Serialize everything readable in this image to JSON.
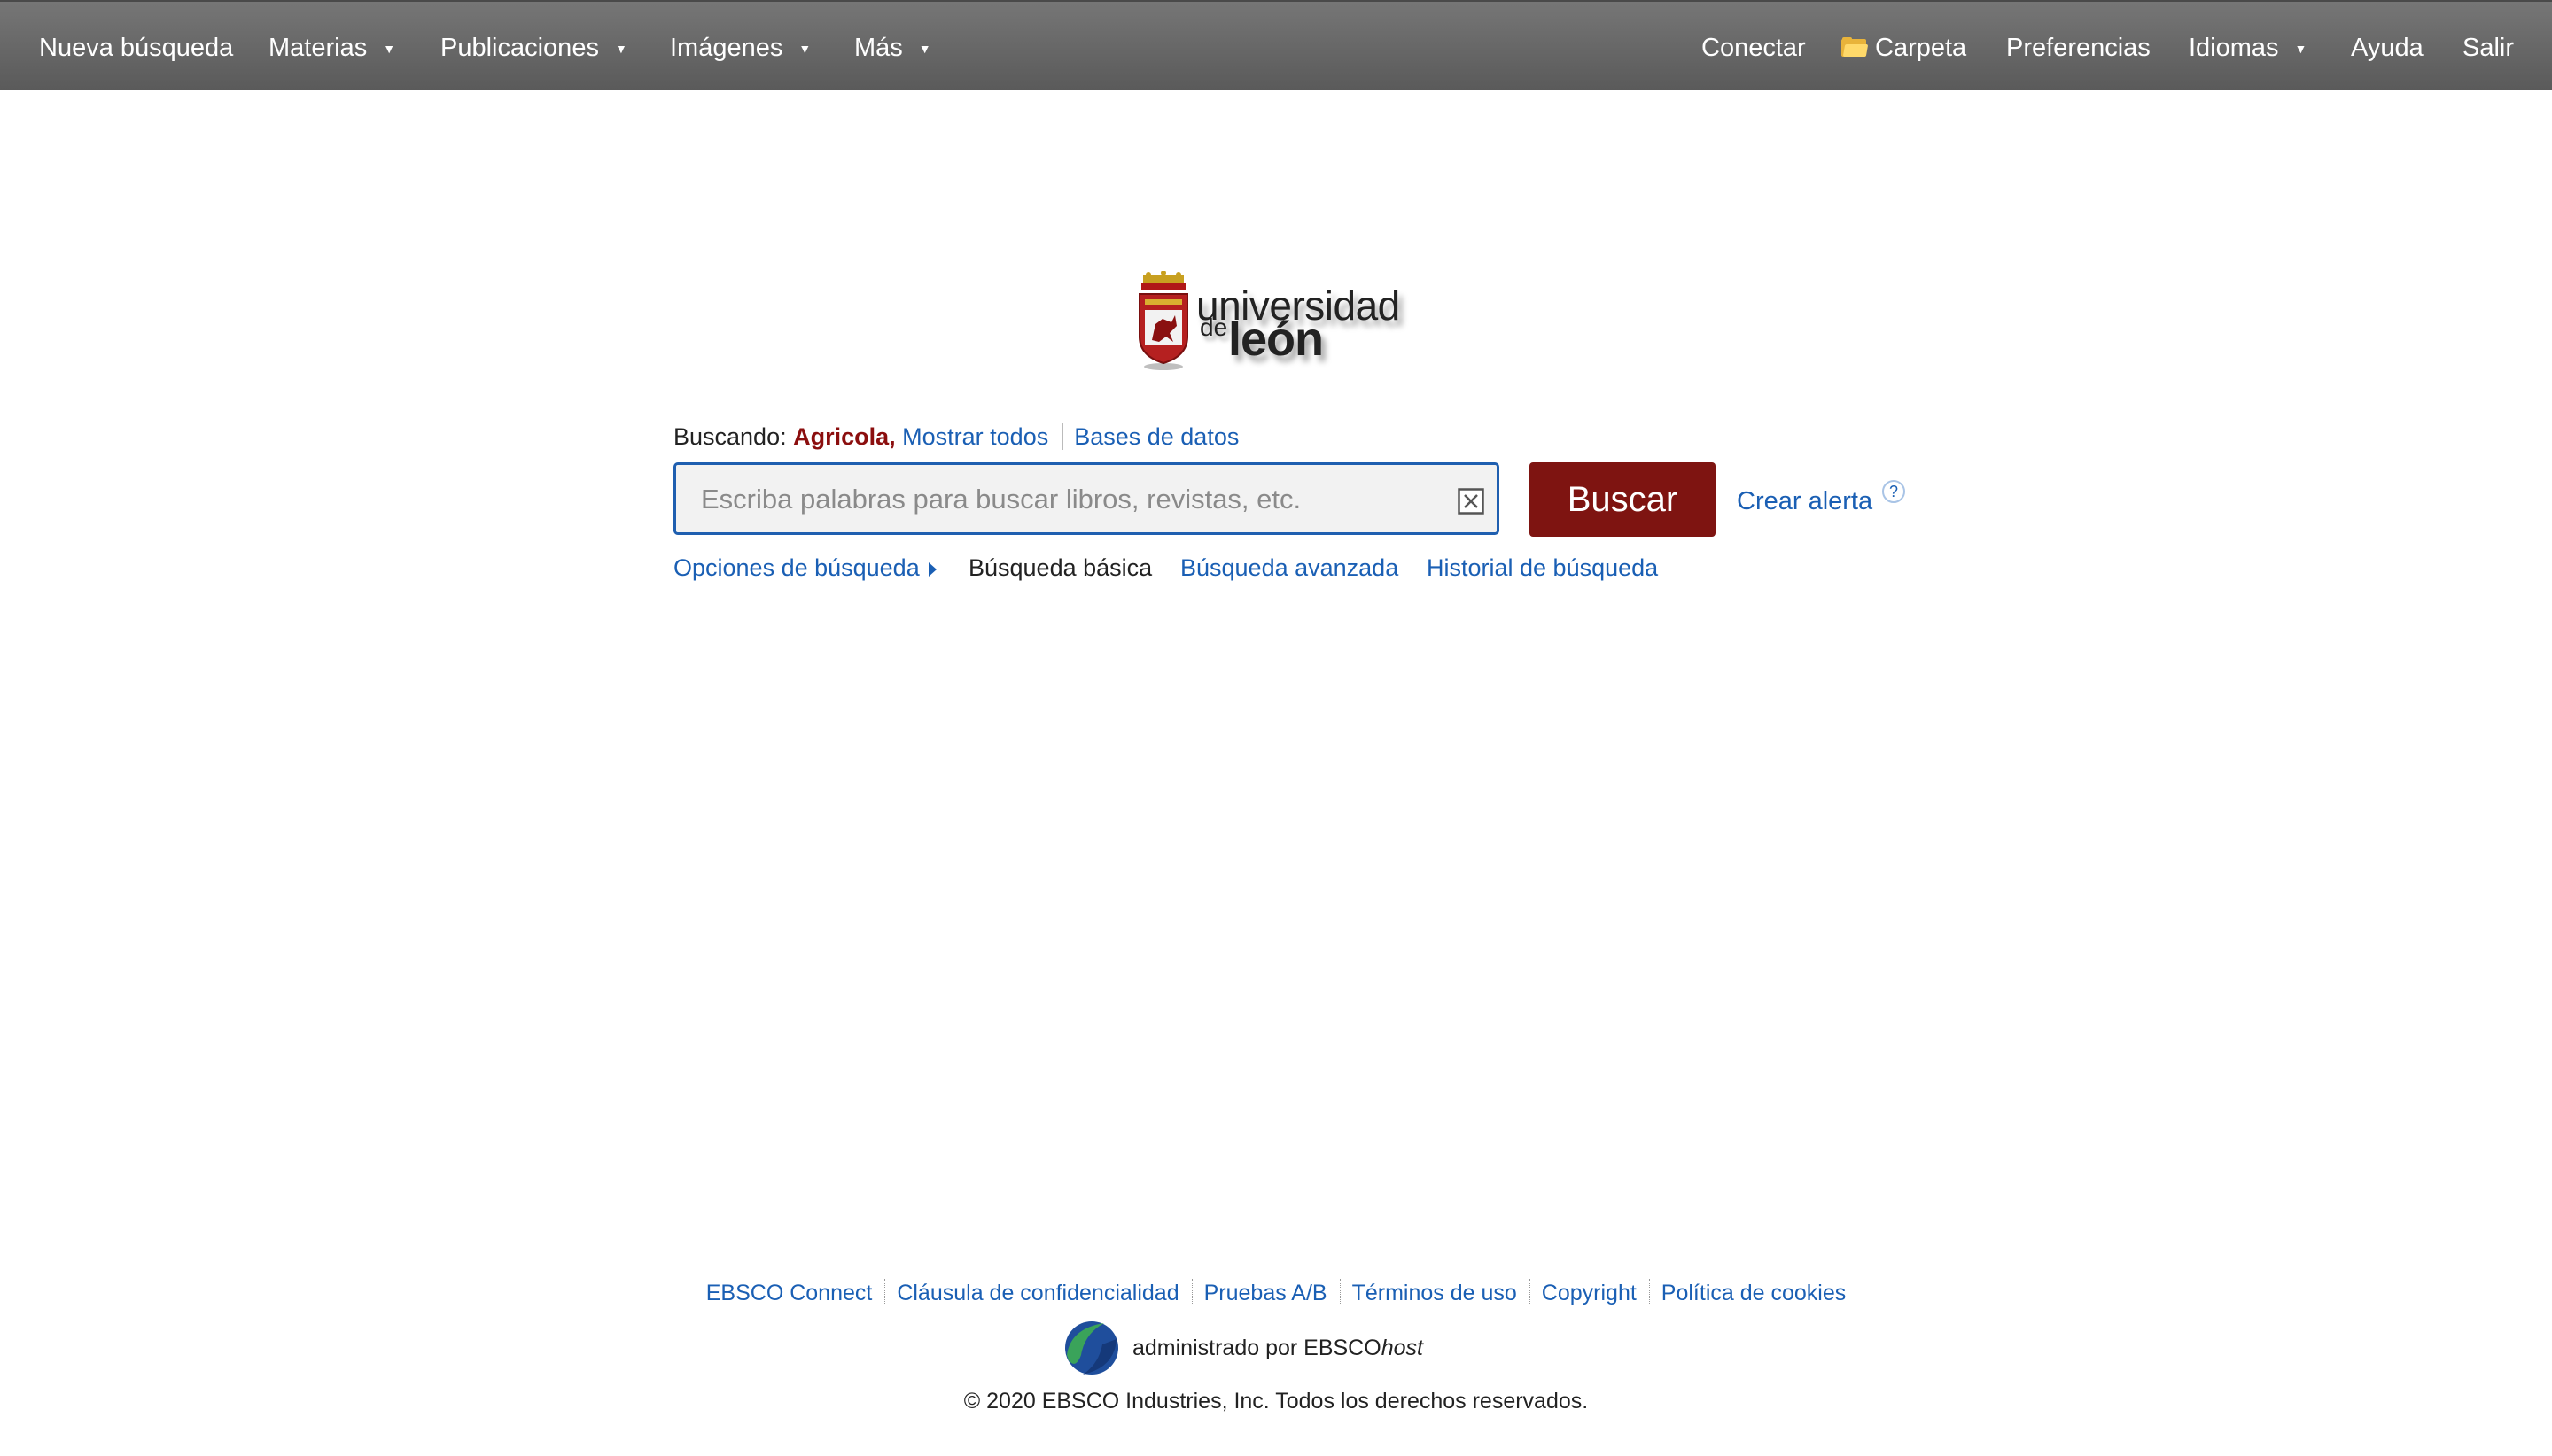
{
  "nav": {
    "new_search": "Nueva búsqueda",
    "subjects": "Materias",
    "publications": "Publicaciones",
    "images": "Imágenes",
    "more": "Más",
    "sign_in": "Conectar",
    "folder": "Carpeta",
    "preferences": "Preferencias",
    "languages": "Idiomas",
    "help": "Ayuda",
    "exit": "Salir"
  },
  "logo": {
    "line1": "universidad",
    "line2_small": "de",
    "line2_big": "león"
  },
  "search": {
    "searching_label": "Buscando:",
    "database": "Agricola,",
    "show_all": "Mostrar todos",
    "databases_link": "Bases de datos",
    "placeholder": "Escriba palabras para buscar libros, revistas, etc.",
    "value": "",
    "button": "Buscar",
    "create_alert": "Crear alerta",
    "help_glyph": "?"
  },
  "search_options": {
    "options": "Opciones de búsqueda",
    "basic": "Búsqueda básica",
    "advanced": "Búsqueda avanzada",
    "history": "Historial de búsqueda"
  },
  "footer": {
    "links": [
      "EBSCO Connect",
      "Cláusula de confidencialidad",
      "Pruebas A/B",
      "Términos de uso",
      "Copyright",
      "Política de cookies"
    ],
    "admin_prefix": "administrado por EBSCO",
    "admin_host": "host",
    "copyright": "© 2020 EBSCO Industries, Inc. Todos los derechos reservados."
  },
  "colors": {
    "topbar": "#666666",
    "link": "#1a5fb4",
    "buscar_button": "#7e1411",
    "database_name": "#8b0e0e",
    "search_border": "#1f5fb0"
  },
  "icons": [
    "caret-down-icon",
    "folder-icon",
    "clear-icon",
    "help-icon",
    "triangle-right-icon",
    "ebsco-logo-icon",
    "university-shield-icon"
  ]
}
